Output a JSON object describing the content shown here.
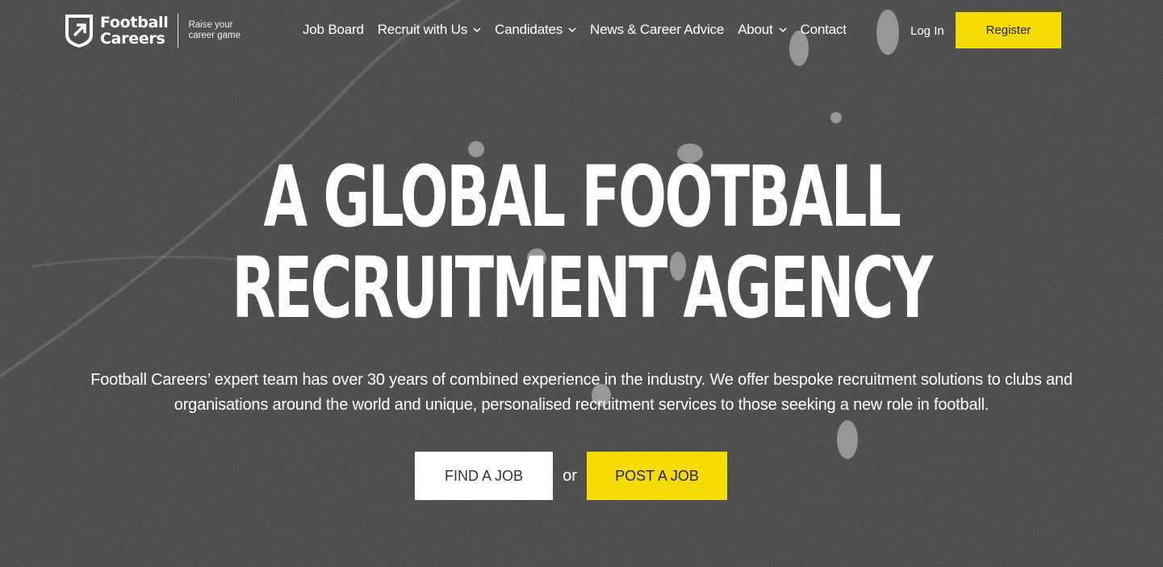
{
  "brand": {
    "name_line1": "Football",
    "name_line2": "Careers",
    "tagline_line1": "Raise your",
    "tagline_line2": "career game"
  },
  "nav": {
    "items": [
      {
        "label": "Job Board",
        "dropdown": false
      },
      {
        "label": "Recruit with Us",
        "dropdown": true
      },
      {
        "label": "Candidates",
        "dropdown": true
      },
      {
        "label": "News & Career Advice",
        "dropdown": false
      },
      {
        "label": "About",
        "dropdown": true
      },
      {
        "label": "Contact",
        "dropdown": false
      }
    ],
    "login_label": "Log In",
    "register_label": "Register"
  },
  "hero": {
    "headline_line1": "A GLOBAL FOOTBALL",
    "headline_line2": "RECRUITMENT AGENCY",
    "description": "Football Careers’ expert team has over 30 years of combined experience in the industry. We offer bespoke recruitment solutions to clubs and organisations around the world and unique, personalised recruitment services to those seeking a new role in football.",
    "find_job_label": "FIND A JOB",
    "or_label": "or",
    "post_job_label": "POST A JOB"
  },
  "colors": {
    "accent": "#f5dc07",
    "background": "#383838",
    "text": "#ffffff"
  }
}
